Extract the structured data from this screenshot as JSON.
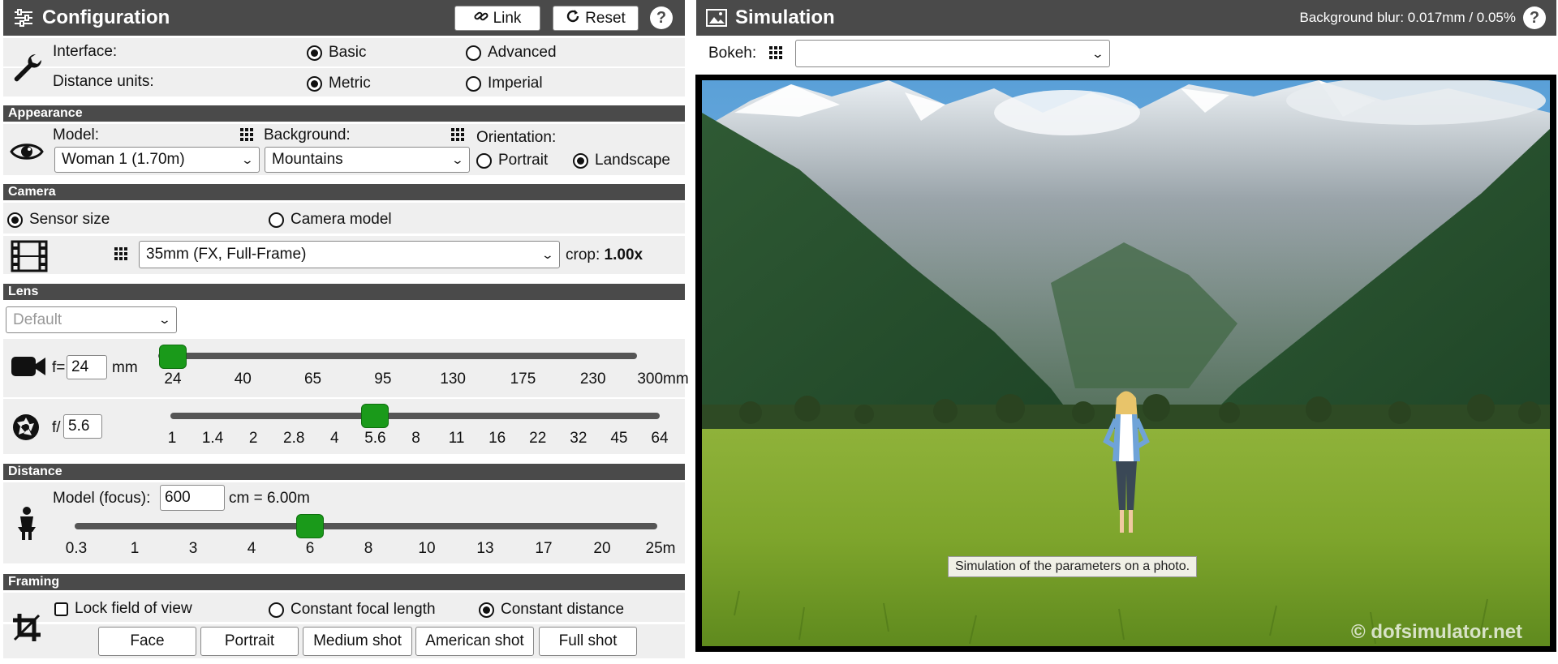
{
  "config": {
    "title": "Configuration",
    "link_label": "Link",
    "reset_label": "Reset",
    "help": "?",
    "interface": {
      "label": "Interface:",
      "options": [
        "Basic",
        "Advanced"
      ],
      "selected": "Basic"
    },
    "units": {
      "label": "Distance units:",
      "options": [
        "Metric",
        "Imperial"
      ],
      "selected": "Metric"
    }
  },
  "appearance": {
    "section": "Appearance",
    "model_label": "Model:",
    "model_value": "Woman 1 (1.70m)",
    "background_label": "Background:",
    "background_value": "Mountains",
    "orientation_label": "Orientation:",
    "orientation_options": [
      "Portrait",
      "Landscape"
    ],
    "orientation_selected": "Landscape"
  },
  "camera": {
    "section": "Camera",
    "mode_options": [
      "Sensor size",
      "Camera model"
    ],
    "mode_selected": "Sensor size",
    "sensor_value": "35mm (FX, Full-Frame)",
    "crop_label": "crop:",
    "crop_value": "1.00x"
  },
  "lens": {
    "section": "Lens",
    "preset": "Default",
    "focal_prefix": "f=",
    "focal_value": "24",
    "focal_unit": "mm",
    "focal_ticks": [
      "24",
      "40",
      "65",
      "95",
      "130",
      "175",
      "230",
      "300mm"
    ],
    "focal_position": 0.0,
    "aperture_prefix": "f/",
    "aperture_value": "5.6",
    "aperture_ticks": [
      "1",
      "1.4",
      "2",
      "2.8",
      "4",
      "5.6",
      "8",
      "11",
      "16",
      "22",
      "32",
      "45",
      "64"
    ],
    "aperture_position": 0.4167
  },
  "distance": {
    "section": "Distance",
    "focus_label": "Model (focus):",
    "focus_value": "600",
    "focus_result": "cm = 6.00m",
    "ticks": [
      "0.3",
      "1",
      "3",
      "4",
      "6",
      "8",
      "10",
      "13",
      "17",
      "20",
      "25m"
    ],
    "position": 0.4
  },
  "framing": {
    "section": "Framing",
    "lock_label": "Lock field of view",
    "lock_checked": false,
    "mode_options": [
      "Constant focal length",
      "Constant distance"
    ],
    "mode_selected": "Constant distance",
    "buttons": [
      "Face",
      "Portrait",
      "Medium shot",
      "American shot",
      "Full shot"
    ]
  },
  "simulation": {
    "title": "Simulation",
    "blur_text": "Background blur: 0.017mm / 0.05%",
    "help": "?",
    "bokeh_label": "Bokeh:",
    "bokeh_value": "",
    "tooltip": "Simulation of the parameters on a photo.",
    "watermark": "© dofsimulator.net"
  },
  "colors": {
    "header": "#4a4a4a",
    "row": "#efefef",
    "slider_thumb": "#1a9a1a"
  }
}
